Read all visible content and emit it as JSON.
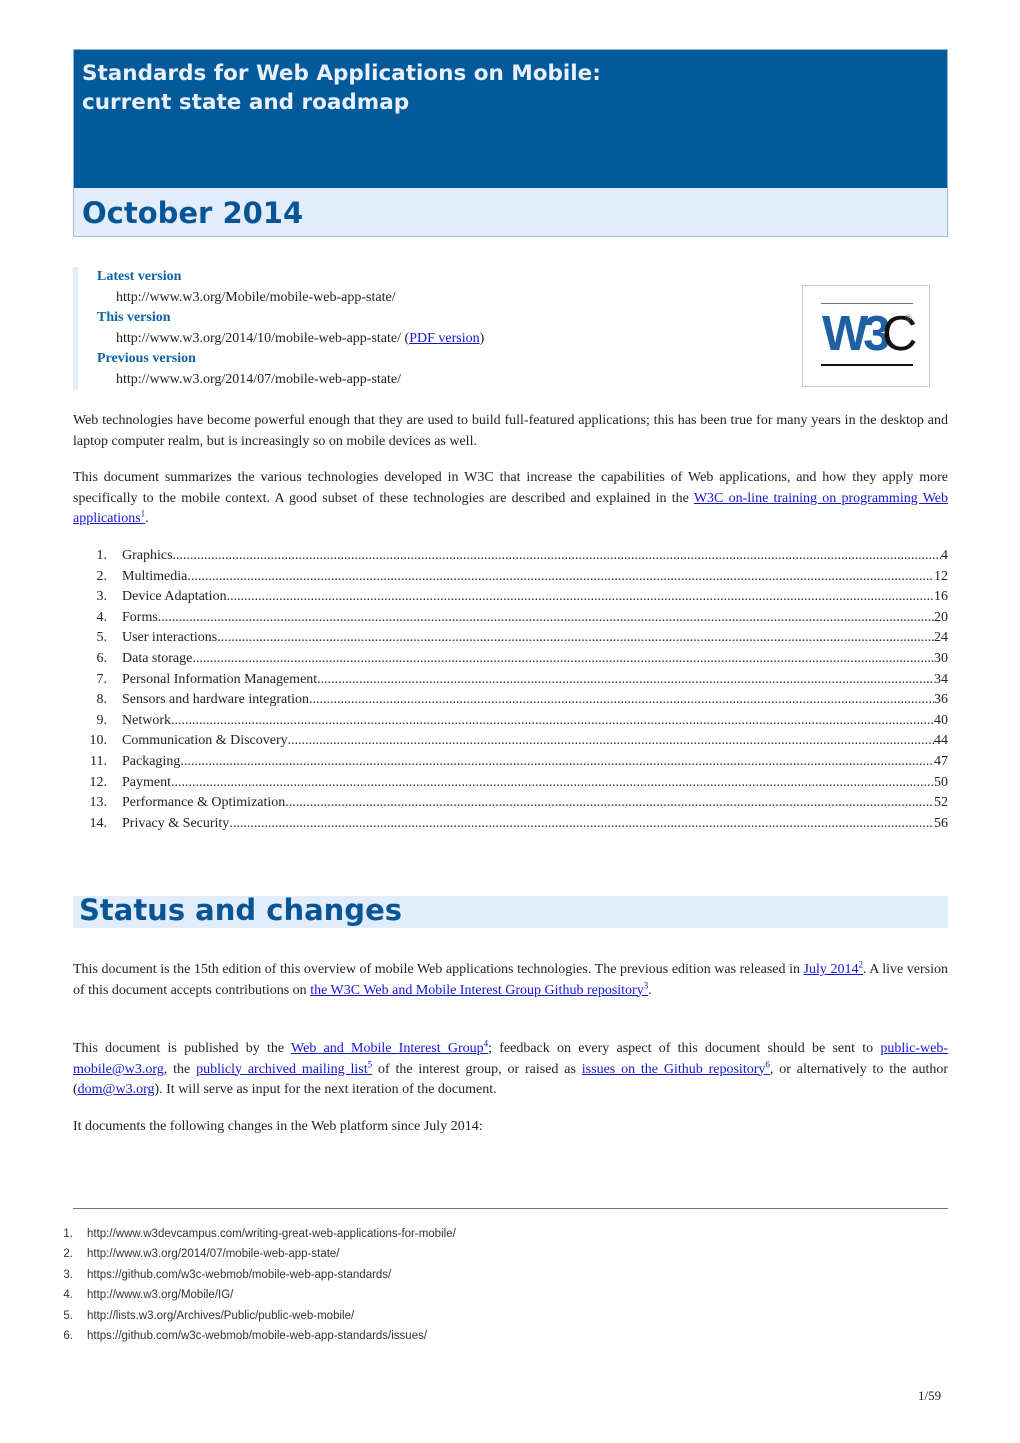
{
  "header": {
    "title_line1": "Standards for Web Applications on Mobile:",
    "title_line2": "current state and roadmap",
    "date": "October 2014"
  },
  "versions": {
    "latest_label": "Latest version",
    "latest_url": "http://www.w3.org/Mobile/mobile-web-app-state/",
    "this_label": "This version",
    "this_url": "http://www.w3.org/2014/10/mobile-web-app-state/",
    "pdf_open": " (",
    "pdf_link": "PDF version",
    "pdf_close": ")",
    "previous_label": "Previous version",
    "previous_url": "http://www.w3.org/2014/07/mobile-web-app-state/"
  },
  "logo": {
    "w3": "W3",
    "c": "C",
    "reg": "®"
  },
  "intro": {
    "p1": "Web technologies have become powerful enough that they are used to build full-featured applications; this has been true for many years in the desktop and laptop computer realm, but is increasingly so on mobile devices as well.",
    "p2_text": "This document summarizes the various technologies developed in W3C that increase the capabilities of Web applications, and how they apply more specifically to the mobile context. A good subset of these technologies are described and explained in the ",
    "p2_link": "W3C on-line training on programming Web applications",
    "p2_sup": "1",
    "p2_end": "."
  },
  "toc": [
    {
      "num": "1.",
      "label": "Graphics",
      "page": "4"
    },
    {
      "num": "2.",
      "label": "Multimedia",
      "page": "12"
    },
    {
      "num": "3.",
      "label": "Device Adaptation",
      "page": "16"
    },
    {
      "num": "4.",
      "label": "Forms",
      "page": "20"
    },
    {
      "num": "5.",
      "label": "User interactions",
      "page": "24"
    },
    {
      "num": "6.",
      "label": "Data storage",
      "page": "30"
    },
    {
      "num": "7.",
      "label": "Personal Information Management",
      "page": "34"
    },
    {
      "num": "8.",
      "label": "Sensors and hardware integration",
      "page": "36"
    },
    {
      "num": "9.",
      "label": "Network",
      "page": "40"
    },
    {
      "num": "10.",
      "label": "Communication & Discovery",
      "page": "44"
    },
    {
      "num": "11.",
      "label": "Packaging",
      "page": "47"
    },
    {
      "num": "12.",
      "label": "Payment",
      "page": "50"
    },
    {
      "num": "13.",
      "label": "Performance & Optimization",
      "page": "52"
    },
    {
      "num": "14.",
      "label": "Privacy & Security",
      "page": "56"
    }
  ],
  "status": {
    "heading": "Status and changes",
    "p1_a": "This document is the 15th edition of this overview of mobile Web applications technologies. The previous edition was released in ",
    "p1_link1": "July 2014",
    "p1_sup1": "2",
    "p1_b": ". A live version of this document accepts contributions on ",
    "p1_link2": "the W3C Web and Mobile Interest Group Github repository",
    "p1_sup2": "3",
    "p1_c": ".",
    "p2_a": "This document is published by the ",
    "p2_link1": "Web and Mobile Interest Group",
    "p2_sup1": "4",
    "p2_b": "; feedback on every aspect of this document should be sent to ",
    "p2_link2": "public-web-mobile@w3.org",
    "p2_c": ", the ",
    "p2_link3": "publicly archived mailing list",
    "p2_sup3": "5",
    "p2_d": " of the interest group, or raised as ",
    "p2_link4": "issues on the Github repository",
    "p2_sup4": "6",
    "p2_e": ", or alternatively to the author (",
    "p2_link5": "dom@w3.org",
    "p2_f": "). It will serve as input for the next iteration of the document.",
    "p3": "It documents the following changes in the Web platform since July 2014:"
  },
  "footnotes": [
    {
      "num": "1.",
      "url": "http://www.w3devcampus.com/writing-great-web-applications-for-mobile/"
    },
    {
      "num": "2.",
      "url": "http://www.w3.org/2014/07/mobile-web-app-state/"
    },
    {
      "num": "3.",
      "url": "https://github.com/w3c-webmob/mobile-web-app-standards/"
    },
    {
      "num": "4.",
      "url": "http://www.w3.org/Mobile/IG/"
    },
    {
      "num": "5.",
      "url": "http://lists.w3.org/Archives/Public/public-web-mobile/"
    },
    {
      "num": "6.",
      "url": "https://github.com/w3c-webmob/mobile-web-app-standards/issues/"
    }
  ],
  "page_number": "1/59",
  "colors": {
    "header_dark": "#025a9b",
    "header_light": "#e2edfc",
    "heading_blue": "#085596",
    "link": "#1515d4"
  }
}
